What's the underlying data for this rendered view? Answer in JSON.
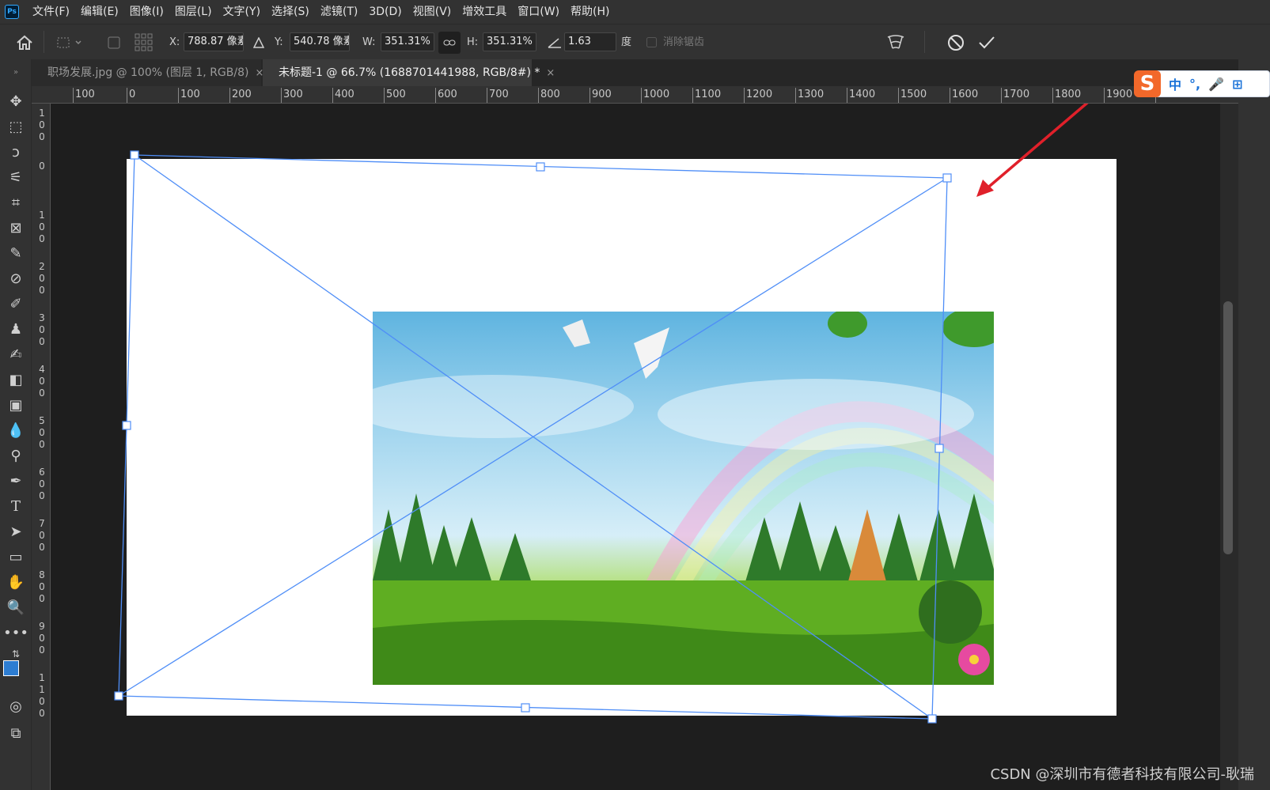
{
  "app": {
    "logo": "Ps"
  },
  "menu": [
    "文件(F)",
    "编辑(E)",
    "图像(I)",
    "图层(L)",
    "文字(Y)",
    "选择(S)",
    "滤镜(T)",
    "3D(D)",
    "视图(V)",
    "增效工具",
    "窗口(W)",
    "帮助(H)"
  ],
  "options": {
    "x_label": "X:",
    "x_value": "788.87 像素",
    "y_label": "Y:",
    "y_value": "540.78 像素",
    "w_label": "W:",
    "w_value": "351.31%",
    "h_label": "H:",
    "h_value": "351.31%",
    "angle_value": "1.63",
    "angle_unit": "度",
    "antialias_label": "消除锯齿"
  },
  "tabs": [
    {
      "label": "职场发展.jpg @ 100% (图层 1, RGB/8)",
      "close": "×"
    },
    {
      "label": "未标题-1 @ 66.7% (1688701441988, RGB/8#) *",
      "close": "×"
    }
  ],
  "ruler": {
    "h_labels": [
      "100",
      "0",
      "100",
      "200",
      "300",
      "400",
      "500",
      "600",
      "700",
      "800",
      "900",
      "1000",
      "1100",
      "1200",
      "1300",
      "1400",
      "1500",
      "1600",
      "1700",
      "1800",
      "1900",
      "2000"
    ],
    "v_labels": [
      "100",
      "0",
      "100",
      "200",
      "300",
      "400",
      "500",
      "600",
      "700",
      "800",
      "900",
      "1100"
    ]
  },
  "ime": {
    "logo": "S",
    "items": [
      "中",
      "°,",
      "🎤",
      "⊞"
    ]
  },
  "watermark": "CSDN @深圳市有德者科技有限公司-耿瑞",
  "colors": {
    "accent": "#4f8ef7",
    "foreground": "#2d7dd2",
    "background": "#ffffff",
    "arrow": "#e0202a"
  }
}
